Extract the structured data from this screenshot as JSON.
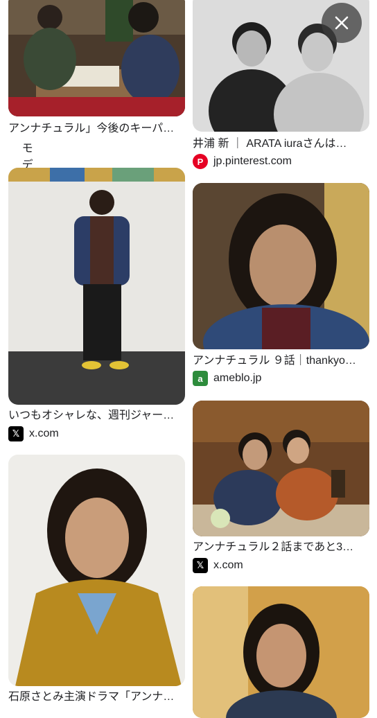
{
  "results": [
    {
      "caption": "アンナチュラル」今後のキーパ…",
      "source": "モデルプレス",
      "favicon": "m-icon"
    },
    {
      "caption": "井浦 新 ｜ ARATA iuraさんは…",
      "source": "jp.pinterest.com",
      "favicon": "pinterest-icon"
    },
    {
      "caption": "いつもオシャレな、週刊ジャー…",
      "source": "x.com",
      "favicon": "x-icon"
    },
    {
      "caption": "アンナチュラル ９話｜thankyo…",
      "source": "ameblo.jp",
      "favicon": "ameba-icon"
    },
    {
      "caption": "アンナチュラル２話まであと3…",
      "source": "x.com",
      "favicon": "x-icon"
    },
    {
      "caption": "石原さとみ主演ドラマ「アンナ…",
      "source": "",
      "favicon": ""
    }
  ],
  "colors": {
    "modelpress": "#e8317a",
    "pinterest": "#e60023",
    "x": "#000000",
    "ameba": "#2d8c3c"
  }
}
